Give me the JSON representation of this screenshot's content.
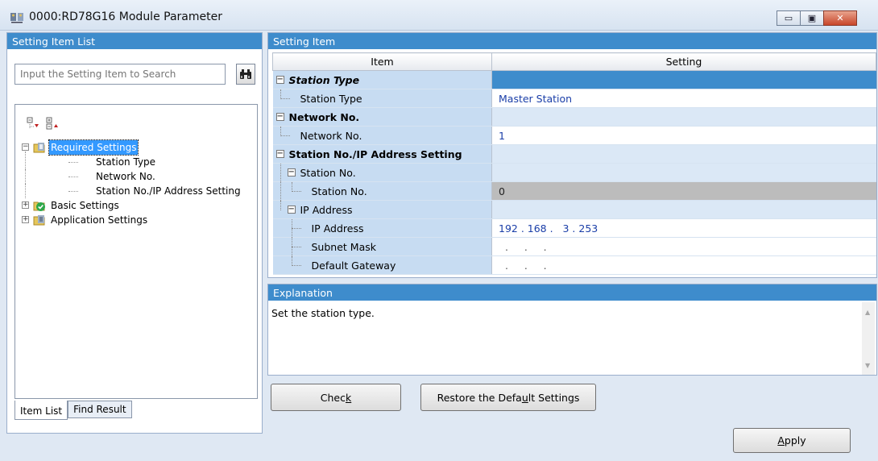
{
  "window": {
    "title": "0000:RD78G16 Module Parameter",
    "minimize_glyph": "▭",
    "maximize_glyph": "▣",
    "close_glyph": "✕"
  },
  "left_panel": {
    "header": "Setting Item List",
    "search_placeholder": "Input the Setting Item to Search",
    "tree": [
      {
        "label": "Required Settings",
        "level": 0,
        "expanded": true,
        "selected": true,
        "icon": "folder-required-icon"
      },
      {
        "label": "Station Type",
        "level": 1
      },
      {
        "label": "Network No.",
        "level": 1
      },
      {
        "label": "Station No./IP Address Setting",
        "level": 1
      },
      {
        "label": "Basic Settings",
        "level": 0,
        "expanded": false,
        "icon": "folder-checked-icon"
      },
      {
        "label": "Application Settings",
        "level": 0,
        "expanded": false,
        "icon": "folder-icon"
      }
    ],
    "tabs": [
      "Item List",
      "Find Result"
    ]
  },
  "setting_item": {
    "header": "Setting Item",
    "columns": [
      "Item",
      "Setting"
    ],
    "rows": [
      {
        "item": "Station Type",
        "setting": "",
        "type": "category"
      },
      {
        "item": "Station Type",
        "setting": "Master Station",
        "type": "item"
      },
      {
        "item": "Network No.",
        "setting": "",
        "type": "category"
      },
      {
        "item": "Network No.",
        "setting": "1",
        "type": "item"
      },
      {
        "item": "Station No./IP Address Setting",
        "setting": "",
        "type": "category"
      },
      {
        "item": "Station No.",
        "setting": "",
        "type": "subcategory"
      },
      {
        "item": "Station No.",
        "setting": "0",
        "type": "item"
      },
      {
        "item": "IP Address",
        "setting": "",
        "type": "subcategory"
      },
      {
        "item": "IP Address",
        "setting": "192 . 168 .   3 . 253",
        "type": "item"
      },
      {
        "item": "Subnet Mask",
        "setting": ".     .     .",
        "type": "item"
      },
      {
        "item": "Default Gateway",
        "setting": ".     .     .",
        "type": "item"
      }
    ]
  },
  "explanation": {
    "header": "Explanation",
    "text": "Set the station type."
  },
  "buttons": {
    "check_pre": "Chec",
    "check_u": "k",
    "restore_pre": "Restore the Defa",
    "restore_u": "u",
    "restore_post": "lt Settings",
    "apply_u": "A",
    "apply_post": "pply"
  },
  "colors": {
    "accent": "#3e8ccc",
    "item_col": "#c7dcf2",
    "selection": "#3399ff"
  }
}
